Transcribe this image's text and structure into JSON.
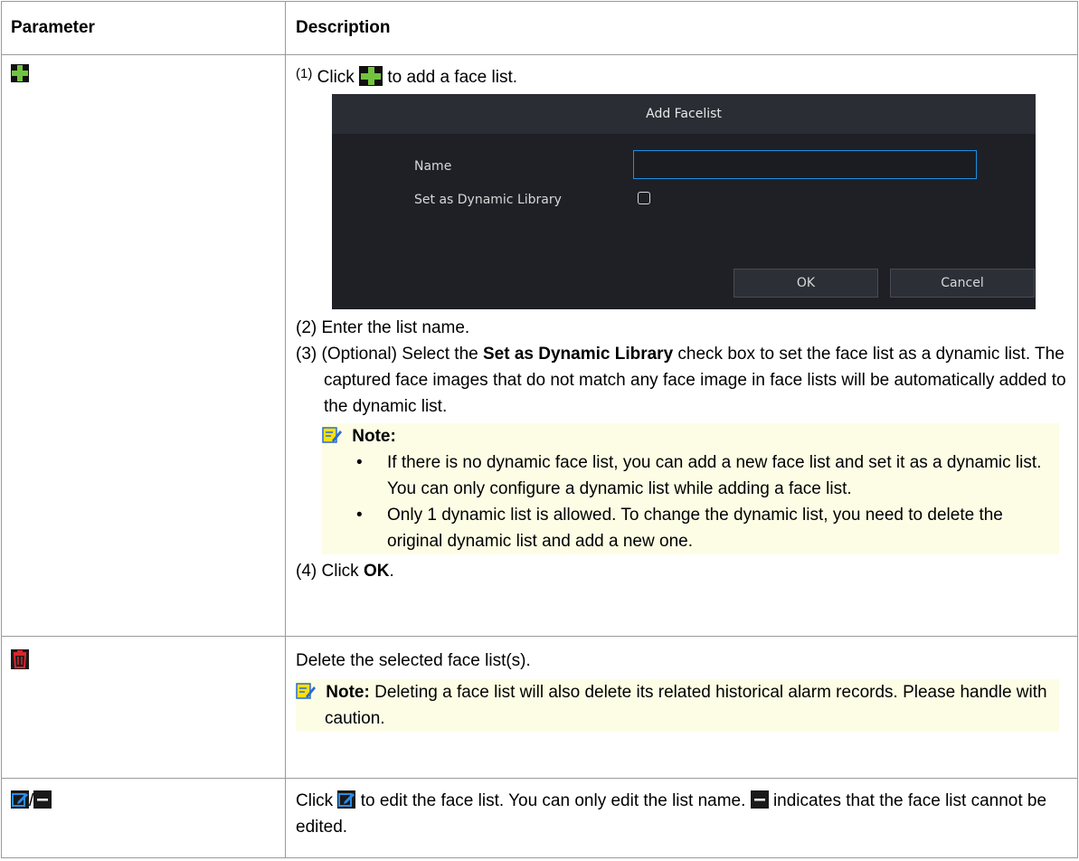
{
  "table": {
    "headers": [
      "Parameter",
      "Description"
    ]
  },
  "row_add": {
    "icon": "add-icon",
    "step1_num": "(1)",
    "step1_pre": "Click",
    "step1_post": "to add a face list.",
    "dialog": {
      "title": "Add Facelist",
      "name_label": "Name",
      "name_value": "",
      "dynamic_label": "Set as Dynamic Library",
      "dynamic_checked": false,
      "ok_label": "OK",
      "cancel_label": "Cancel"
    },
    "step2": "(2) Enter the list name.",
    "step3_pre": "(3) (Optional) Select the",
    "step3_bold": "Set as Dynamic Library",
    "step3_post": "check box to set the face list as a dynamic list. The captured face images that do not match any face image in face lists will be automatically added to the dynamic list.",
    "note_label": "Note:",
    "note_bullets": [
      "If there is no dynamic face list, you can add a new face list and set it as a dynamic list. You can only configure a dynamic list while adding a face list.",
      "Only 1 dynamic list is allowed. To change the dynamic list, you need to delete the original dynamic list and add a new one."
    ],
    "step4_pre": "(4) Click",
    "step4_bold": "OK",
    "step4_post": "."
  },
  "row_delete": {
    "icon": "trash-icon",
    "desc": "Delete the selected face list(s).",
    "note_label": "Note:",
    "note_text": "Deleting a face list will also delete its related historical alarm records. Please handle with caution."
  },
  "row_edit": {
    "icons": [
      "edit-icon",
      "minus-icon"
    ],
    "separator": "/",
    "desc_pre": "Click",
    "desc_mid": "to edit the face list. You can only edit the list name.",
    "desc_post": "indicates that the face list cannot be edited."
  },
  "colors": {
    "add_green": "#72c43f",
    "delete_red": "#d9262c",
    "edit_blue": "#2a8de8",
    "note_bg": "#fdfde5",
    "dialog_bg": "#1e2026",
    "input_border": "#1f8fe0"
  }
}
